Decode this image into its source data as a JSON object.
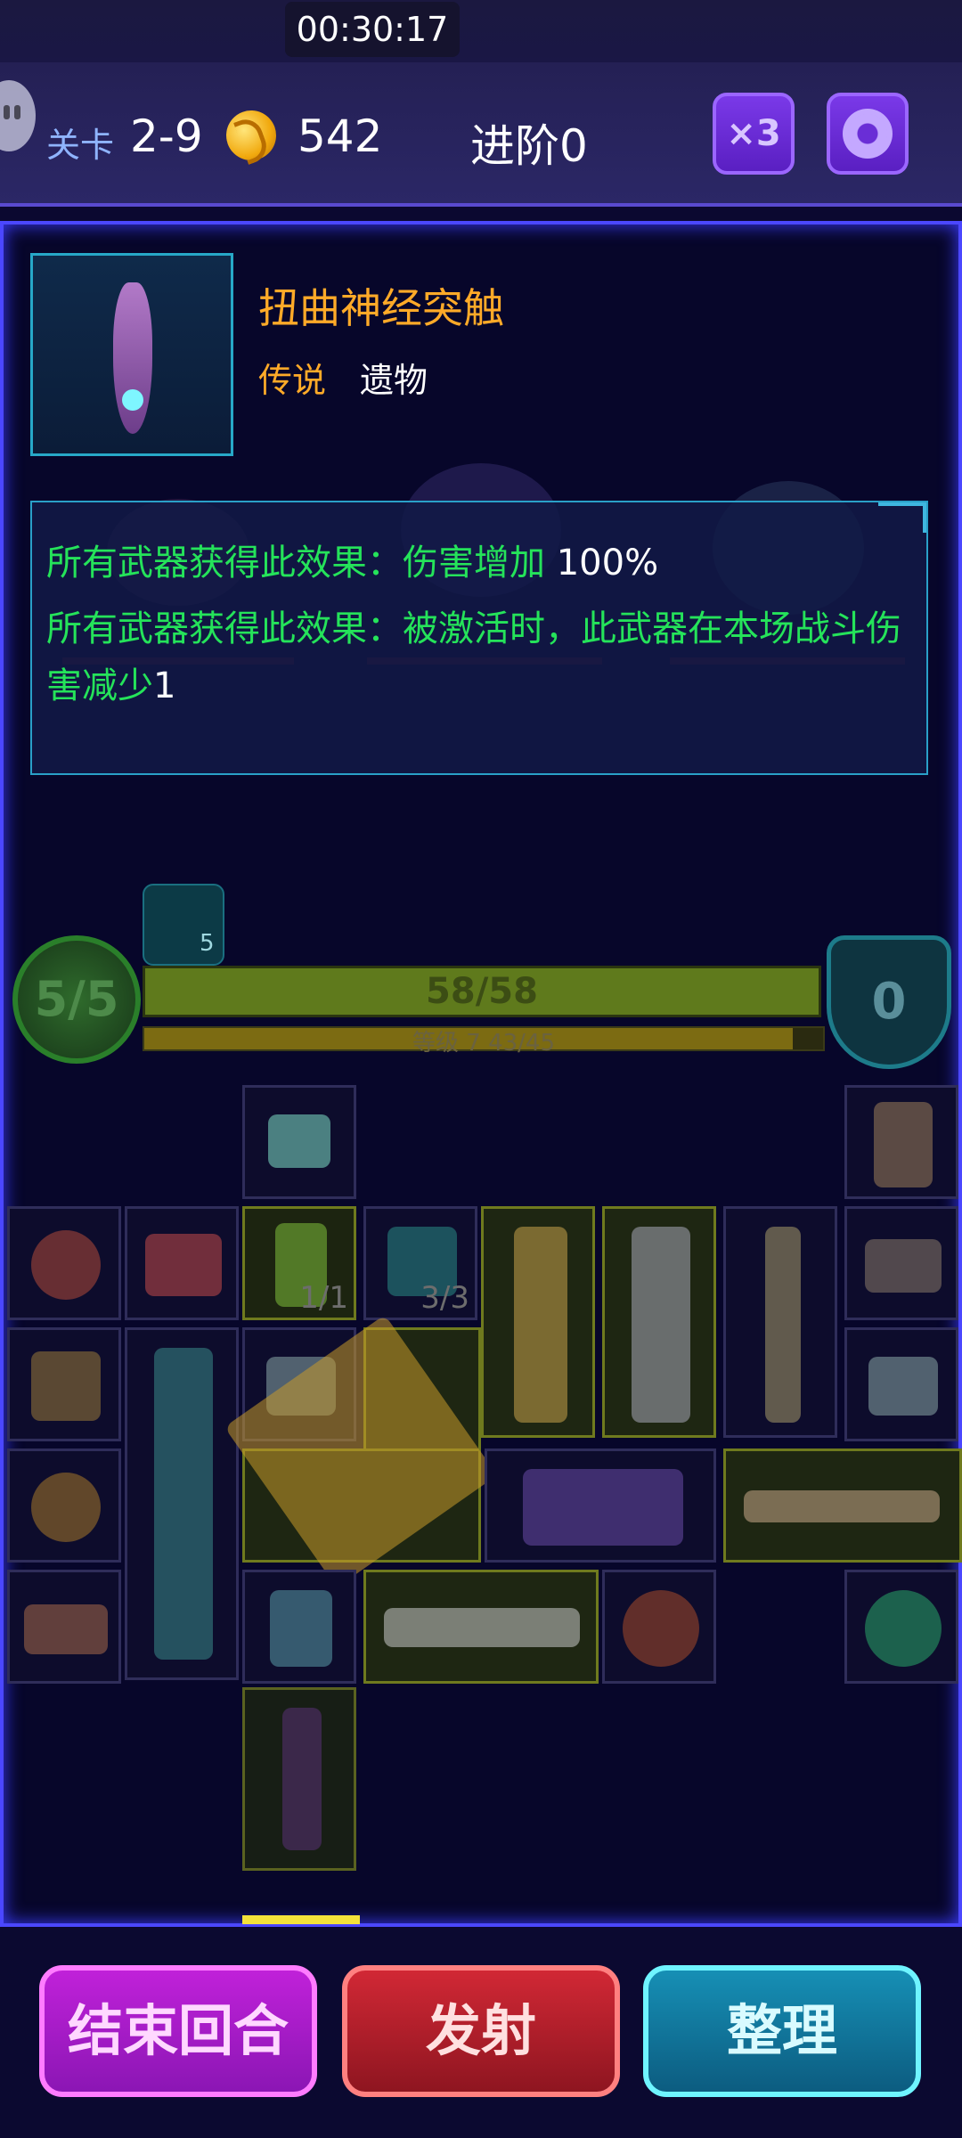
{
  "status": {
    "clock": "00:30:17"
  },
  "header": {
    "level_label": "关卡",
    "level_value": "2-9",
    "coins": "542",
    "advance": "进阶0",
    "speed_label": "×3"
  },
  "item": {
    "name": "扭曲神经突触",
    "rarity": "传说",
    "type": "遗物",
    "effect1_text": "所有武器获得此效果：伤害增加 ",
    "effect1_value": "100%",
    "effect2_text": "所有武器获得此效果：被激活时，此武器在本场战斗伤害减少",
    "effect2_value": "1"
  },
  "battle": {
    "player_hp_circle": "5/5",
    "power_count": "5",
    "hp_bar": "58/58",
    "xp_text": "等级 7  43/45",
    "xp_fraction": 0.955,
    "shield": "0"
  },
  "inventory": {
    "count_a": "1/1",
    "count_b": "3/3"
  },
  "buttons": {
    "end_turn": "结束回合",
    "fire": "发射",
    "sort": "整理"
  },
  "colors": {
    "accent_purple": "#7a39e8",
    "legend_orange": "#ffaa28",
    "effect_green": "#25e35a",
    "panel_border": "#4b47ff"
  }
}
